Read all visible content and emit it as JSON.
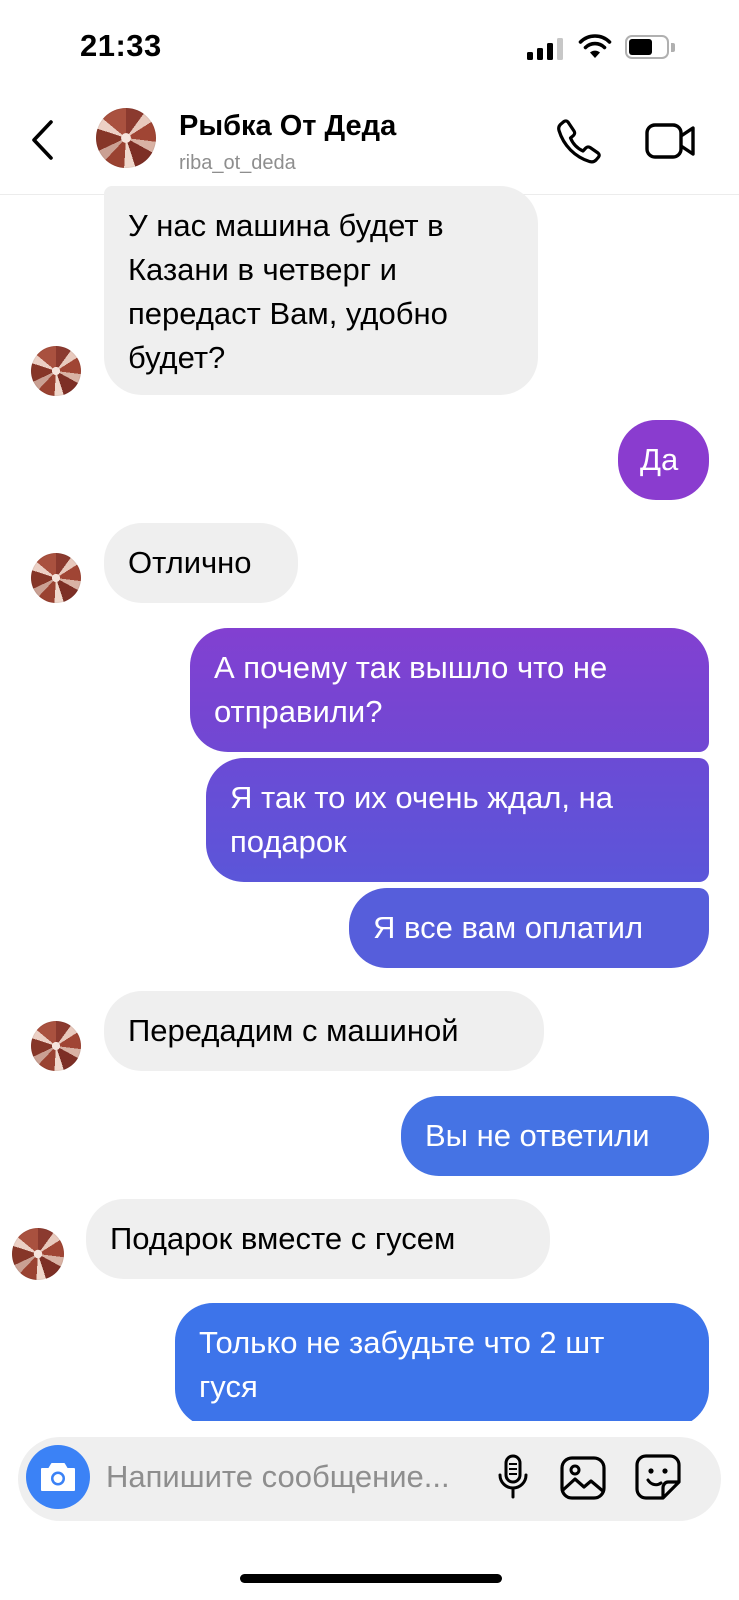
{
  "status_bar": {
    "time": "21:33"
  },
  "header": {
    "name": "Рыбка От Деда",
    "username": "riba_ot_deda",
    "icons": [
      "back-chevron-icon",
      "phone-icon",
      "video-camera-icon"
    ]
  },
  "messages": [
    {
      "from": "them",
      "text": "У нас машина будет в\nКазани в четверг и\nпередаст Вам, удобно\nбудет?"
    },
    {
      "from": "me",
      "text": "Да"
    },
    {
      "from": "them",
      "text": "Отлично"
    },
    {
      "from": "me",
      "text": "А почему так вышло что не\nотправили?"
    },
    {
      "from": "me",
      "text": "Я так то их очень ждал, на\nподарок"
    },
    {
      "from": "me",
      "text": "Я все вам оплатил"
    },
    {
      "from": "them",
      "text": "Передадим с машиной"
    },
    {
      "from": "me",
      "text": "Вы не ответили"
    },
    {
      "from": "them",
      "text": "Подарок вместе с гусем"
    },
    {
      "from": "me",
      "text": "Только не забудьте что 2 шт\nгуся"
    }
  ],
  "composer": {
    "placeholder": "Напишите сообщение...",
    "icons": [
      "camera-icon",
      "microphone-icon",
      "gallery-icon",
      "sticker-icon"
    ]
  },
  "colors": {
    "incoming_bubble": "#efefef",
    "outgoing_purple": "#8a3ccf",
    "outgoing_violet": "#6450d6",
    "outgoing_blue": "#3d74ea",
    "camera_button": "#3b82f6"
  }
}
